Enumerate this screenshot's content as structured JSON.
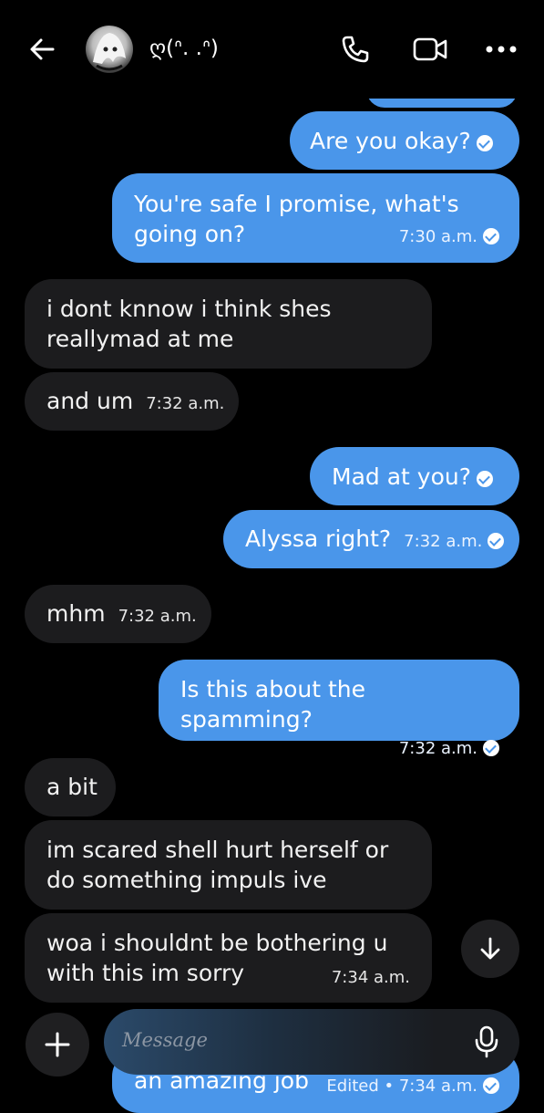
{
  "header": {
    "title": "ღ(ᐢ. .ᐢ)",
    "icons": [
      "back-arrow-icon",
      "phone-icon",
      "video-icon",
      "more-icon"
    ]
  },
  "messages": [
    {
      "from": "me",
      "text": "",
      "time": ""
    },
    {
      "from": "me",
      "text": "Are you okay?",
      "time": ""
    },
    {
      "from": "me",
      "text": "You're safe I promise, what's going on?",
      "line1": "You're safe I promise, what's",
      "line2": "going on?",
      "time": "7:30 a.m."
    },
    {
      "from": "them",
      "text": "i dont knnow i think shes reallymad at me",
      "line1": "i dont knnow i think shes",
      "line2": "reallymad at me",
      "time": ""
    },
    {
      "from": "them",
      "text": "and um",
      "time": "7:32 a.m."
    },
    {
      "from": "me",
      "text": "Mad at you?",
      "time": ""
    },
    {
      "from": "me",
      "text": "Alyssa right?",
      "time": "7:32 a.m."
    },
    {
      "from": "them",
      "text": "mhm",
      "time": "7:32 a.m."
    },
    {
      "from": "me",
      "text": "Is this about the spamming?",
      "time": "7:32 a.m."
    },
    {
      "from": "them",
      "text": "a bit",
      "time": ""
    },
    {
      "from": "them",
      "text": "im scared shell hurt herself or do something impuls ive",
      "line1": "im scared shell hurt herself or",
      "line2": "do something impuls ive",
      "time": ""
    },
    {
      "from": "them",
      "text": "woa i shouldnt be bothering u with this im sorry",
      "line1": "woa i shouldnt be bothering u",
      "line2": "with this im sorry",
      "time": "7:34 a.m."
    },
    {
      "from": "me",
      "text": "an amazing job",
      "time": "Edited • 7:34 a.m."
    }
  ],
  "composer": {
    "placeholder": "Message",
    "icons": [
      "plus-icon",
      "mic-icon"
    ]
  },
  "scroll_button": {
    "icon": "arrow-down-icon"
  },
  "colors": {
    "outgoing": "#4a96ea",
    "incoming": "#1c1c1e",
    "background": "#000000"
  }
}
